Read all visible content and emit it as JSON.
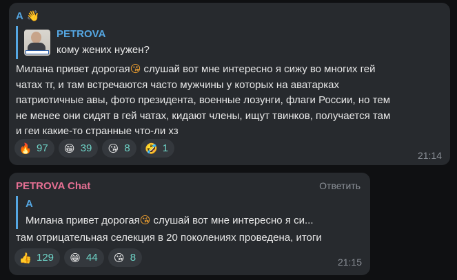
{
  "messages": [
    {
      "sender": "A",
      "sender_color": "#55a7e3",
      "sender_icon": "waving-hand-icon",
      "quote": {
        "author": "PETROVA",
        "text": "кому жених нужен?",
        "has_thumbnail": true
      },
      "body_lines": [
        "Милана привет дорогая",
        "слушай вот мне интересно я сижу во многих гей",
        "чатах тг, и там встречаются часто мужчины у которых на аватарках",
        "патриотичные авы, фото президента, военные лозунги, флаги России, но тем",
        "не менее они сидят в гей чатах, кидают члены, ищут твинков, получается там",
        "и геи какие-то странные что-ли хз"
      ],
      "inline_emoji": "face-blowing-kiss-icon",
      "reactions": [
        {
          "icon": "fire-icon",
          "count": "97"
        },
        {
          "icon": "beaming-face-icon",
          "count": "39"
        },
        {
          "icon": "face-blowing-kiss-icon",
          "count": "8"
        },
        {
          "icon": "rolling-laughing-face-icon",
          "count": "1"
        }
      ],
      "time": "21:14"
    },
    {
      "sender": "PETROVA Chat",
      "sender_color": "#e56f93",
      "reply_label": "Ответить",
      "quote": {
        "author": "A",
        "text_before": "Милана привет дорогая",
        "text_after": "слушай вот мне интересно я си..."
      },
      "body": "там отрицательная селекция в 20 поколениях проведена, итоги",
      "reactions": [
        {
          "icon": "thumbs-up-icon",
          "count": "129"
        },
        {
          "icon": "beaming-face-icon",
          "count": "44"
        },
        {
          "icon": "face-blowing-kiss-icon",
          "count": "8"
        }
      ],
      "time": "21:15"
    }
  ],
  "colors": {
    "background": "#0f1012",
    "bubble": "#272a2e",
    "reaction_bg": "#34383d",
    "reaction_count": "#6ed3c7",
    "quote_accent": "#55a7e3",
    "meta_text": "#8a8f96"
  }
}
